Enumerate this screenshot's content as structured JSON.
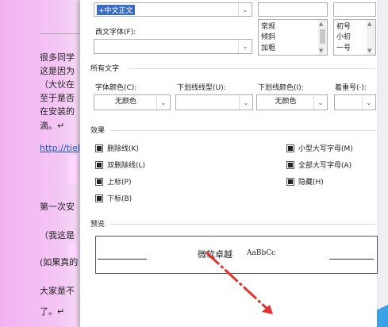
{
  "doc": {
    "lines": [
      "很多同学",
      "这是因为",
      "（大伙在",
      "至于是否",
      "在安装的",
      "滴。↵"
    ],
    "link": "http://tiel",
    "lines2": [
      "第一次安",
      "（我这是",
      "(如果真的",
      "大家是不",
      "了。↵"
    ]
  },
  "dialog": {
    "chinese_font_value": "+中文正文",
    "western_font_label": "西文字体(F):",
    "western_font_value": "",
    "style_list": [
      "常规",
      "倾斜",
      "加粗"
    ],
    "size_list": [
      "初号",
      "小初",
      "一号"
    ],
    "all_text_label": "所有文字",
    "font_color_label": "字体颜色(C):",
    "font_color_value": "无颜色",
    "underline_style_label": "下划线线型(U):",
    "underline_color_label": "下划线颜色(I):",
    "underline_color_value": "无颜色",
    "emphasis_label": "着重号(·):",
    "effects_label": "效果",
    "effects": {
      "strikethrough": "删除线(K)",
      "double_strikethrough": "双删除线(L)",
      "superscript": "上标(P)",
      "subscript": "下标(B)",
      "small_caps": "小型大写字母(M)",
      "all_caps": "全部大写字母(A)",
      "hidden": "隐藏(H)"
    },
    "preview_label": "预览",
    "preview_text": "微软卓越",
    "preview_sample": "AaBbCc"
  },
  "colors": {
    "arrow": "#e53030",
    "page_pink": "#f2b2f2",
    "corner": "#3aa1e8"
  }
}
